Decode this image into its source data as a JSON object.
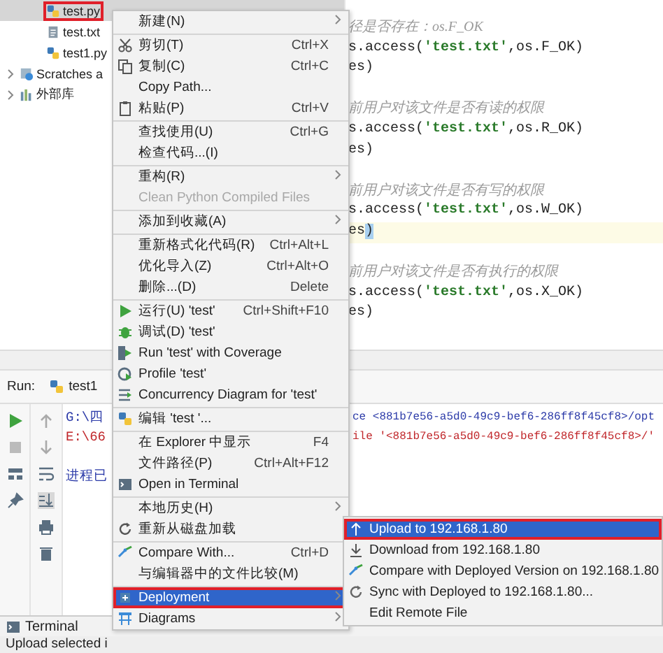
{
  "project_tree": {
    "files": [
      {
        "label": "test.py",
        "kind": "python",
        "selected": true,
        "annotated": true
      },
      {
        "label": "test.txt",
        "kind": "text",
        "selected": false,
        "annotated": false
      },
      {
        "label": "test1.py",
        "kind": "python",
        "selected": false,
        "annotated": false
      }
    ],
    "roots": [
      {
        "label": "Scratches a",
        "kind": "scratches",
        "expanded": false
      },
      {
        "label": "外部库",
        "kind": "library",
        "expanded": false
      }
    ]
  },
  "editor": {
    "lines": [
      {
        "kind": "comment",
        "current": false,
        "parts": [
          {
            "text": "径是否存在：os.F_OK",
            "kind": "plain"
          }
        ]
      },
      {
        "kind": "code",
        "current": false,
        "parts": [
          {
            "text": "s.access(",
            "kind": "plain"
          },
          {
            "text": "'test.txt'",
            "kind": "string"
          },
          {
            "text": ",os.F_OK)",
            "kind": "plain"
          }
        ]
      },
      {
        "kind": "code",
        "current": false,
        "parts": [
          {
            "text": "es)",
            "kind": "plain"
          }
        ]
      },
      {
        "kind": "blank",
        "current": false
      },
      {
        "kind": "comment",
        "current": false,
        "parts": [
          {
            "text": "前用户对该文件是否有读的权限",
            "kind": "plain"
          }
        ]
      },
      {
        "kind": "code",
        "current": false,
        "parts": [
          {
            "text": "s.access(",
            "kind": "plain"
          },
          {
            "text": "'test.txt'",
            "kind": "string"
          },
          {
            "text": ",os.R_OK)",
            "kind": "plain"
          }
        ]
      },
      {
        "kind": "code",
        "current": false,
        "parts": [
          {
            "text": "es)",
            "kind": "plain"
          }
        ]
      },
      {
        "kind": "blank",
        "current": false
      },
      {
        "kind": "comment",
        "current": false,
        "parts": [
          {
            "text": "前用户对该文件是否有写的权限",
            "kind": "plain"
          }
        ]
      },
      {
        "kind": "code",
        "current": false,
        "parts": [
          {
            "text": "s.access(",
            "kind": "plain"
          },
          {
            "text": "'test.txt'",
            "kind": "string"
          },
          {
            "text": ",os.W_OK)",
            "kind": "plain"
          }
        ]
      },
      {
        "kind": "code",
        "current": true,
        "parts": [
          {
            "text": "es",
            "kind": "plain"
          },
          {
            "text": ")",
            "kind": "brace"
          }
        ]
      },
      {
        "kind": "blank",
        "current": false
      },
      {
        "kind": "comment",
        "current": false,
        "parts": [
          {
            "text": "前用户对该文件是否有执行的权限",
            "kind": "plain"
          }
        ]
      },
      {
        "kind": "code",
        "current": false,
        "parts": [
          {
            "text": "s.access(",
            "kind": "plain"
          },
          {
            "text": "'test.txt'",
            "kind": "string"
          },
          {
            "text": ",os.X_OK)",
            "kind": "plain"
          }
        ]
      },
      {
        "kind": "code",
        "current": false,
        "parts": [
          {
            "text": "es)",
            "kind": "plain"
          }
        ]
      }
    ]
  },
  "run_panel": {
    "label": "Run:",
    "tab": "test1",
    "console": [
      {
        "kind": "command",
        "start": "G:\\四",
        "end": "ce <881b7e56-a5d0-49c9-bef6-286ff8f45cf8>/opt"
      },
      {
        "kind": "error",
        "start": "E:\\66",
        "end": "ile '<881b7e56-a5d0-49c9-bef6-286ff8f45cf8>/'"
      },
      {
        "kind": "blank"
      },
      {
        "kind": "command",
        "start": "进程已"
      }
    ]
  },
  "tool_windows": [
    {
      "label": "Terminal"
    }
  ],
  "status_bar": {
    "text": "Upload selected i"
  },
  "context_menu": {
    "groups": [
      [
        {
          "label": "新建(N)",
          "kind": "plain",
          "submenu": true,
          "disabled": false,
          "selected": false,
          "annotated": false
        }
      ],
      [
        {
          "label": "剪切(T)",
          "kind": "cut",
          "shortcut": "Ctrl+X",
          "submenu": false,
          "disabled": false,
          "selected": false,
          "annotated": false
        },
        {
          "label": "复制(C)",
          "kind": "copy",
          "shortcut": "Ctrl+C",
          "submenu": false,
          "disabled": false,
          "selected": false,
          "annotated": false
        },
        {
          "label": "Copy Path...",
          "kind": "plain",
          "submenu": false,
          "disabled": false,
          "selected": false,
          "annotated": false
        },
        {
          "label": "粘贴(P)",
          "kind": "paste",
          "shortcut": "Ctrl+V",
          "submenu": false,
          "disabled": false,
          "selected": false,
          "annotated": false
        }
      ],
      [
        {
          "label": "查找使用(U)",
          "kind": "plain",
          "shortcut": "Ctrl+G",
          "submenu": false,
          "disabled": false,
          "selected": false,
          "annotated": false
        },
        {
          "label": "检查代码...(I)",
          "kind": "plain",
          "submenu": false,
          "disabled": false,
          "selected": false,
          "annotated": false
        }
      ],
      [
        {
          "label": "重构(R)",
          "kind": "plain",
          "submenu": true,
          "disabled": false,
          "selected": false,
          "annotated": false
        },
        {
          "label": "Clean Python Compiled Files",
          "kind": "plain",
          "submenu": false,
          "disabled": true,
          "selected": false,
          "annotated": false
        }
      ],
      [
        {
          "label": "添加到收藏(A)",
          "kind": "plain",
          "submenu": true,
          "disabled": false,
          "selected": false,
          "annotated": false
        }
      ],
      [
        {
          "label": "重新格式化代码(R)",
          "kind": "plain",
          "shortcut": "Ctrl+Alt+L",
          "submenu": false,
          "disabled": false,
          "selected": false,
          "annotated": false
        },
        {
          "label": "优化导入(Z)",
          "kind": "plain",
          "shortcut": "Ctrl+Alt+O",
          "submenu": false,
          "disabled": false,
          "selected": false,
          "annotated": false
        },
        {
          "label": "删除...(D)",
          "kind": "plain",
          "shortcut": "Delete",
          "submenu": false,
          "disabled": false,
          "selected": false,
          "annotated": false
        }
      ],
      [
        {
          "label": "运行(U) 'test'",
          "kind": "run",
          "shortcut": "Ctrl+Shift+F10",
          "submenu": false,
          "disabled": false,
          "selected": false,
          "annotated": false
        },
        {
          "label": "调试(D) 'test'",
          "kind": "debug",
          "submenu": false,
          "disabled": false,
          "selected": false,
          "annotated": false
        },
        {
          "label": "Run 'test' with Coverage",
          "kind": "coverage",
          "submenu": false,
          "disabled": false,
          "selected": false,
          "annotated": false
        },
        {
          "label": "Profile 'test'",
          "kind": "profile",
          "submenu": false,
          "disabled": false,
          "selected": false,
          "annotated": false
        },
        {
          "label": "Concurrency Diagram for 'test'",
          "kind": "concurrency",
          "submenu": false,
          "disabled": false,
          "selected": false,
          "annotated": false
        }
      ],
      [
        {
          "label": "编辑 'test '...",
          "kind": "python",
          "submenu": false,
          "disabled": false,
          "selected": false,
          "annotated": false
        }
      ],
      [
        {
          "label": "在 Explorer 中显示",
          "kind": "plain",
          "shortcut": "F4",
          "submenu": false,
          "disabled": false,
          "selected": false,
          "annotated": false
        },
        {
          "label": "文件路径(P)",
          "kind": "plain",
          "shortcut": "Ctrl+Alt+F12",
          "submenu": false,
          "disabled": false,
          "selected": false,
          "annotated": false
        },
        {
          "label": "Open in Terminal",
          "kind": "terminal",
          "submenu": false,
          "disabled": false,
          "selected": false,
          "annotated": false
        }
      ],
      [
        {
          "label": "本地历史(H)",
          "kind": "plain",
          "submenu": true,
          "disabled": false,
          "selected": false,
          "annotated": false
        },
        {
          "label": "重新从磁盘加载",
          "kind": "reload",
          "submenu": false,
          "disabled": false,
          "selected": false,
          "annotated": false
        }
      ],
      [
        {
          "label": "Compare With...",
          "kind": "compare",
          "shortcut": "Ctrl+D",
          "submenu": false,
          "disabled": false,
          "selected": false,
          "annotated": false
        },
        {
          "label": "与编辑器中的文件比较(M)",
          "kind": "plain",
          "submenu": false,
          "disabled": false,
          "selected": false,
          "annotated": false
        }
      ],
      [
        {
          "label": "Deployment",
          "kind": "deploy",
          "submenu": true,
          "disabled": false,
          "selected": true,
          "annotated": true
        },
        {
          "label": "Diagrams",
          "kind": "diagram",
          "submenu": true,
          "disabled": false,
          "selected": false,
          "annotated": false
        }
      ]
    ]
  },
  "submenu": {
    "items": [
      {
        "label": "Upload to 192.168.1.80",
        "kind": "upload",
        "selected": true,
        "annotated": true
      },
      {
        "label": "Download from 192.168.1.80",
        "kind": "download",
        "selected": false,
        "annotated": false
      },
      {
        "label": "Compare with Deployed Version on 192.168.1.80",
        "kind": "compare",
        "selected": false,
        "annotated": false
      },
      {
        "label": "Sync with Deployed to 192.168.1.80...",
        "kind": "sync",
        "selected": false,
        "annotated": false
      },
      {
        "label": "Edit Remote File",
        "kind": "plain",
        "selected": false,
        "annotated": false
      }
    ]
  }
}
